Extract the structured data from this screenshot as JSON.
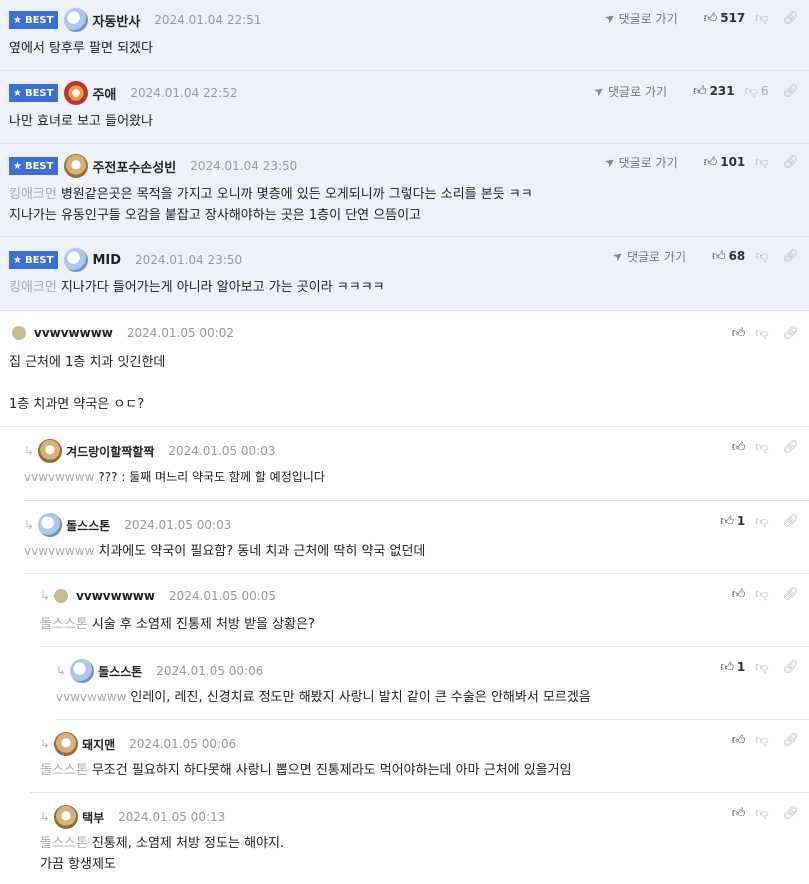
{
  "reply_to_label": "댓글로 가기",
  "best_label": "BEST",
  "best_comments": [
    {
      "nick": "자동반사",
      "date": "2024.01.04 22:51",
      "up": "517",
      "down": "",
      "text": "옆에서 탕후루 팔면 되겠다"
    },
    {
      "nick": "주애",
      "date": "2024.01.04 22:52",
      "up": "231",
      "down": "6",
      "text": "나만 효녀로 보고 들어왔나"
    },
    {
      "nick": "주전포수손성빈",
      "date": "2024.01.04 23:50",
      "up": "101",
      "down": "",
      "mention": "킹애크먼",
      "text": "병원같은곳은 목적을 가지고 오니까 몇층에 있든 오게되니까 그렇다는 소리를 본듯 ㅋㅋ",
      "text2": "지나가는 유동인구들 오감을 붙잡고 장사해야하는 곳은 1층이 단연 으뜸이고"
    },
    {
      "nick": "MID",
      "date": "2024.01.04 23:50",
      "up": "68",
      "down": "",
      "mention": "킹애크먼",
      "text": "지나가다 들어가는게 아니라 알아보고 가는 곳이라 ㅋㅋㅋㅋ"
    }
  ],
  "comments": [
    {
      "nick": "vvwvwwww",
      "date": "2024.01.05 00:02",
      "up": "",
      "text": "집 근처에 1층 치과 잇긴한데",
      "text2": "1층 치과면 약국은 ㅇㄷ?"
    },
    {
      "nick": "겨드랑이할짝할짝",
      "date": "2024.01.05 00:03",
      "up": "",
      "mention": "vvwvwwww",
      "text": "??? : 둘째 며느리 약국도 함께 할 예정입니다"
    },
    {
      "nick": "돌스스톤",
      "date": "2024.01.05 00:03",
      "up": "1",
      "mention": "vvwvwwww",
      "text": "치과에도 약국이 필요함? 동네 치과 근처에 딱히 약국 없던데"
    },
    {
      "nick": "vvwvwwww",
      "date": "2024.01.05 00:05",
      "up": "",
      "mention": "돌스스톤",
      "text": "시술 후 소염제 진통제 처방 받을 상황은?"
    },
    {
      "nick": "돌스스톤",
      "date": "2024.01.05 00:06",
      "up": "1",
      "mention": "vvwvwwww",
      "text": "인레이, 레진, 신경치료 정도만 해봤지 사랑니 발치 같이 큰 수술은 안해봐서 모르겠음"
    },
    {
      "nick": "돼지맨",
      "date": "2024.01.05 00:06",
      "up": "",
      "mention": "돌스스톤",
      "text": "무조건 필요하지 하다못해 사랑니 뽑으면 진통제라도 먹어야하는데 아마 근처에 있을거임"
    },
    {
      "nick": "택부",
      "date": "2024.01.05 00:13",
      "up": "",
      "mention": "돌스스톤",
      "text": "진통제, 소염제 처방 정도는 해야지.",
      "text2": "가끔 항생제도"
    }
  ]
}
